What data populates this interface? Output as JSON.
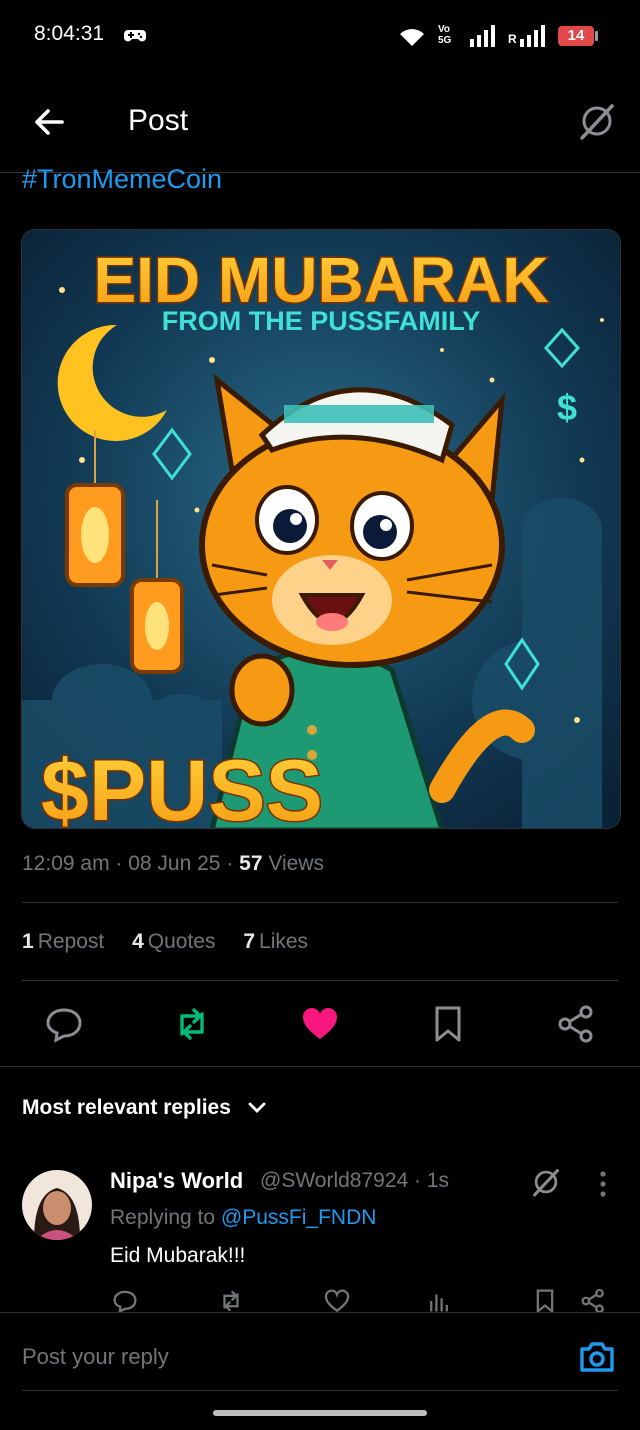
{
  "status_bar": {
    "time": "8:04:31",
    "net_label_top": "Vo",
    "net_label_bottom": "5G",
    "roaming": "R",
    "battery": "14"
  },
  "header": {
    "title": "Post"
  },
  "tweet": {
    "hashtag": "#TronMemeCoin",
    "image": {
      "headline": "EID MUBARAK",
      "subline": "FROM THE PUSSFAMILY",
      "ticker": "$PUSS"
    },
    "time": "12:09 am",
    "date": "08 Jun 25",
    "views_count": "57",
    "views_label": "Views",
    "reposts_count": "1",
    "reposts_label": "Repost",
    "quotes_count": "4",
    "quotes_label": "Quotes",
    "likes_count": "7",
    "likes_label": "Likes"
  },
  "replies": {
    "sort_label": "Most relevant replies",
    "items": [
      {
        "name": "Nipa's World",
        "handle": "@SWorld87924 · 1s",
        "replying_prefix": "Replying to",
        "replying_to": "@PussFi_FNDN",
        "text": "Eid Mubarak!!!"
      }
    ]
  },
  "composer": {
    "placeholder": "Post your reply"
  },
  "colors": {
    "accent": "#1d9bf0",
    "repost_active": "#00ba7c",
    "like_active": "#f91880",
    "muted": "#71767b",
    "background": "#000000"
  }
}
